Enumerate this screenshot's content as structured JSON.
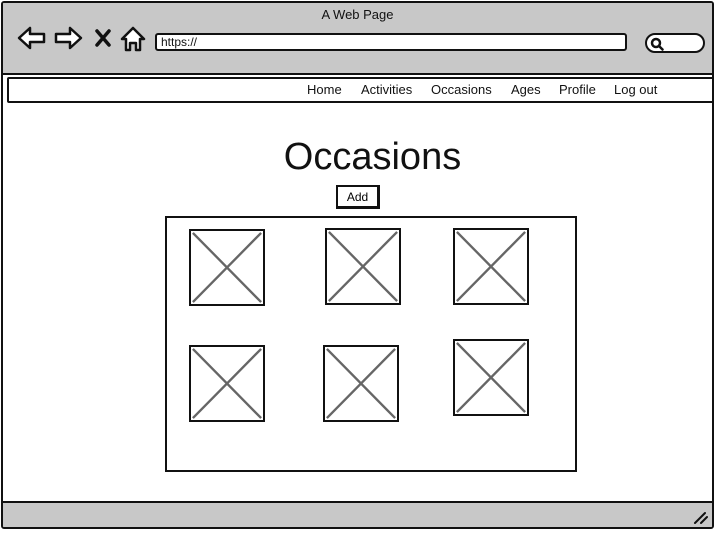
{
  "window": {
    "title": "A Web Page"
  },
  "browser": {
    "url": "https://",
    "icons": [
      "back-arrow-icon",
      "forward-arrow-icon",
      "close-x-icon",
      "home-icon",
      "search-icon"
    ]
  },
  "menu": {
    "items": [
      {
        "label": "Home"
      },
      {
        "label": "Activities"
      },
      {
        "label": "Occasions"
      },
      {
        "label": "Ages"
      },
      {
        "label": "Profile"
      },
      {
        "label": "Log out"
      }
    ]
  },
  "main": {
    "title": "Occasions",
    "add_label": "Add",
    "tile_icon": "image-placeholder-icon"
  },
  "colors": {
    "chrome": "#c8c8c8",
    "ink": "#111111",
    "placeholder_x": "#666666"
  }
}
